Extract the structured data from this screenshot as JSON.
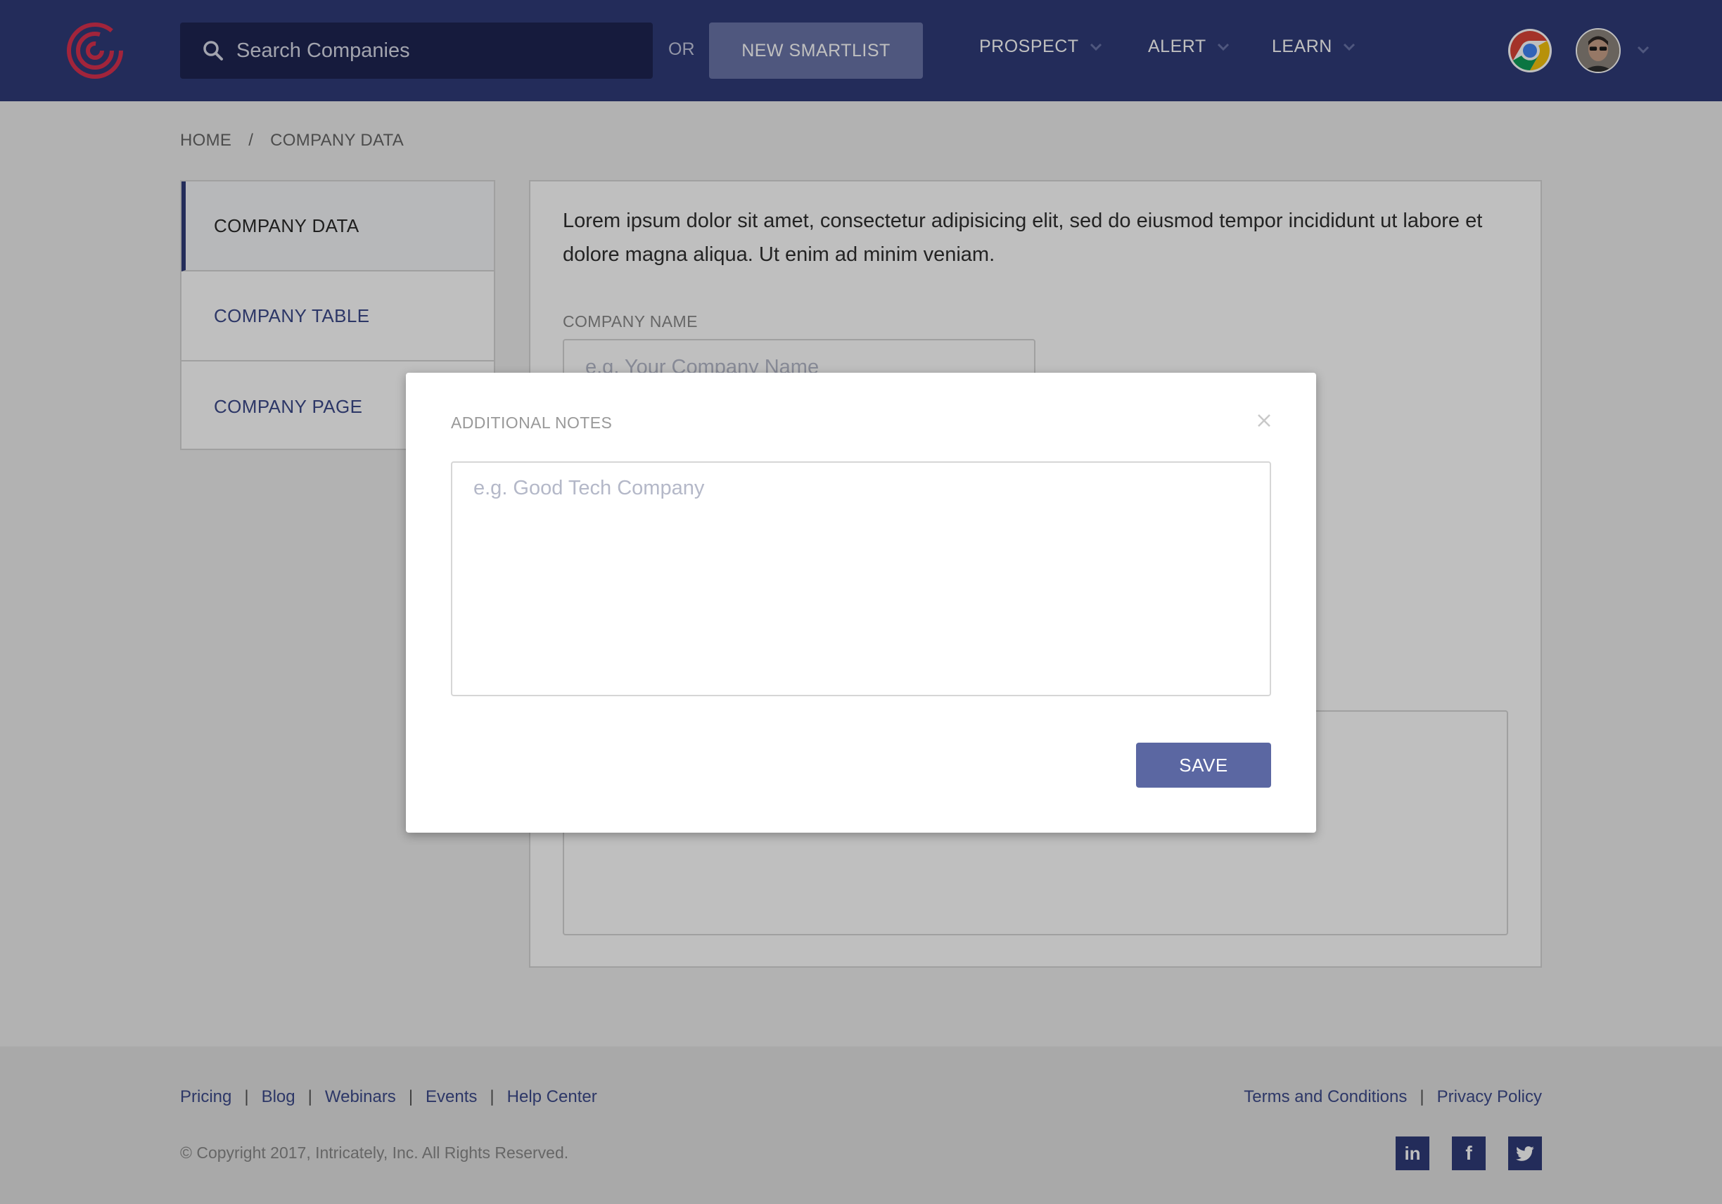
{
  "header": {
    "logo_icon": "target-logo-icon",
    "search": {
      "placeholder": "Search Companies"
    },
    "or_label": "OR",
    "new_smartlist_label": "NEW SMARTLIST",
    "nav": [
      {
        "label": "PROSPECT"
      },
      {
        "label": "ALERT"
      },
      {
        "label": "LEARN"
      }
    ]
  },
  "breadcrumb": {
    "home": "HOME",
    "separator": "/",
    "current": "COMPANY DATA"
  },
  "sidebar": {
    "items": [
      {
        "label": "COMPANY DATA",
        "active": true
      },
      {
        "label": "COMPANY TABLE",
        "active": false
      },
      {
        "label": "COMPANY PAGE",
        "active": false
      }
    ]
  },
  "main": {
    "intro": "Lorem ipsum dolor sit amet, consectetur adipisicing elit, sed do eiusmod tempor incididunt ut labore et dolore magna aliqua. Ut enim ad minim veniam.",
    "company_name_label": "COMPANY NAME",
    "company_name_placeholder": "e.g. Your Company Name"
  },
  "modal": {
    "title": "ADDITIONAL NOTES",
    "textarea_placeholder": "e.g. Good Tech Company",
    "save_label": "SAVE"
  },
  "footer": {
    "links": [
      "Pricing",
      "Blog",
      "Webinars",
      "Events",
      "Help Center"
    ],
    "link_separator": "|",
    "legal": [
      "Terms and Conditions",
      "Privacy Policy"
    ],
    "copyright": "© Copyright 2017, Intricately, Inc. All Rights Reserved.",
    "social": [
      {
        "label": "in",
        "icon": "linkedin-icon"
      },
      {
        "label": "f",
        "icon": "facebook-icon"
      },
      {
        "label": "twitter",
        "icon": "twitter-icon"
      }
    ]
  },
  "colors": {
    "header_bg": "#2f3b78",
    "search_bg": "#1e2452",
    "accent": "#5b67a2",
    "logo": "#d9314f"
  }
}
